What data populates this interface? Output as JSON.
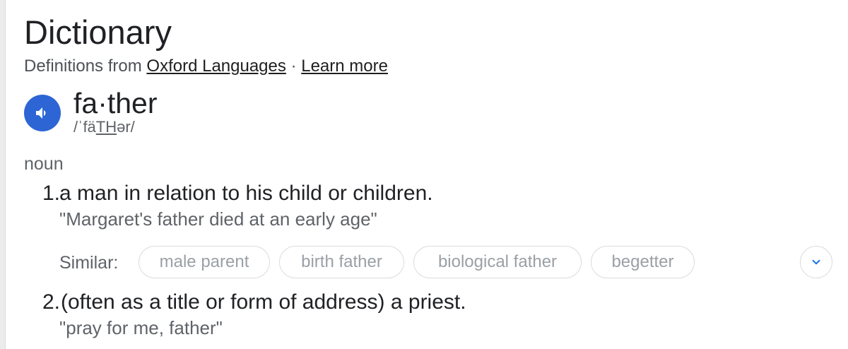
{
  "header": {
    "title": "Dictionary",
    "source_prefix": "Definitions from",
    "source_link": "Oxford Languages",
    "separator": "·",
    "learn_more": "Learn more"
  },
  "entry": {
    "word": "fa·ther",
    "pronunciation_start": "/ˈfä",
    "pronunciation_underlined": "TH",
    "pronunciation_end": "ər/",
    "speaker_icon": "volume-icon",
    "part_of_speech": "noun",
    "definitions": [
      {
        "number": "1.",
        "text": "a man in relation to his child or children.",
        "example": "\"Margaret's father died at an early age\""
      },
      {
        "number": "2.",
        "text": "(often as a title or form of address) a priest.",
        "example": "\"pray for me, father\""
      }
    ],
    "similar_label": "Similar:",
    "similar": [
      "male parent",
      "birth father",
      "biological father",
      "begetter"
    ],
    "expand_icon": "chevron-down-icon"
  },
  "colors": {
    "accent": "#2d65d4",
    "chevron": "#1a73e8",
    "text": "#202124",
    "secondary_text": "#5f6368",
    "chip_text": "#9aa0a6",
    "border": "#dadce0"
  }
}
